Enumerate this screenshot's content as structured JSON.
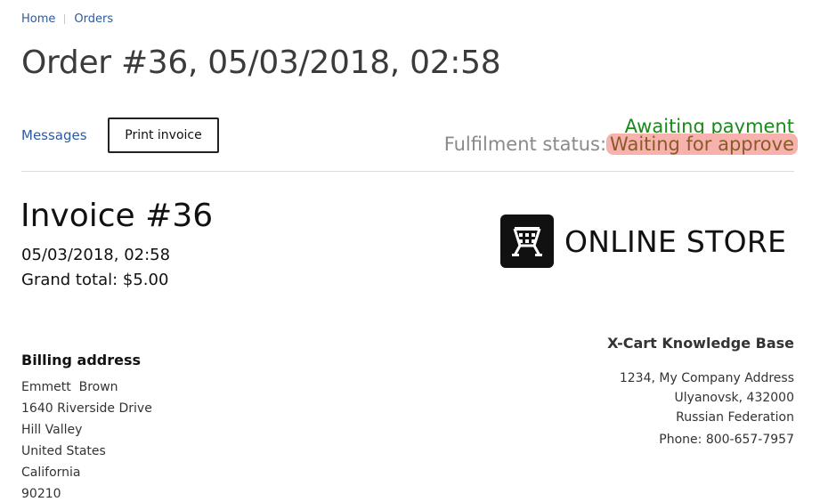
{
  "breadcrumb": {
    "items": [
      "Home",
      "Orders"
    ]
  },
  "page_title": "Order #36, 05/03/2018, 02:58",
  "actions": {
    "messages_label": "Messages",
    "print_invoice_label": "Print invoice"
  },
  "status": {
    "payment": "Awaiting payment",
    "fulfilment_label": "Fulfilment status:",
    "fulfilment_value": "Waiting for approve",
    "payment_color": "#1a8a1a",
    "fulfilment_highlight_color": "#f7b2ad"
  },
  "invoice": {
    "title": "Invoice #36",
    "date": "05/03/2018, 02:58",
    "grand_total": "Grand total: $5.00"
  },
  "logo": {
    "icon": "cart-logo-icon",
    "text": "ONLINE STORE"
  },
  "company": {
    "name": "X-Cart Knowledge Base",
    "address_lines": [
      "1234, My Company Address",
      "Ulyanovsk, 432000",
      "Russian Federation"
    ],
    "phone": "Phone: 800-657-7957"
  },
  "billing": {
    "title": "Billing address",
    "lines": [
      "Emmett  Brown",
      "1640 Riverside Drive",
      "Hill Valley",
      "United States",
      "California",
      "90210"
    ]
  }
}
